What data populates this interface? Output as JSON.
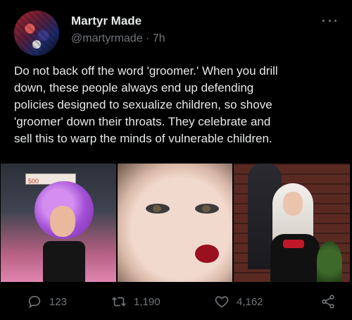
{
  "tweet": {
    "author_name": "Martyr Made",
    "handle": "@martyrmade",
    "separator": "·",
    "time": "7h",
    "text": "Do not back off the word 'groomer.'  When you drill\ndown, these people always end up defending\npolicies designed to sexualize children, so shove\n'groomer' down their throats. They celebrate and\nsell this to warp the minds of vulnerable children.",
    "photo1_sign": "500"
  },
  "actions": {
    "replies": "123",
    "retweets": "1,190",
    "likes": "4,162"
  },
  "icons": {
    "more": "more-dots-icon",
    "reply": "reply-icon",
    "retweet": "retweet-icon",
    "like": "heart-icon",
    "share": "share-icon"
  },
  "colors": {
    "background": "#000000",
    "text": "#e7e9ea",
    "secondary": "#71767b"
  }
}
